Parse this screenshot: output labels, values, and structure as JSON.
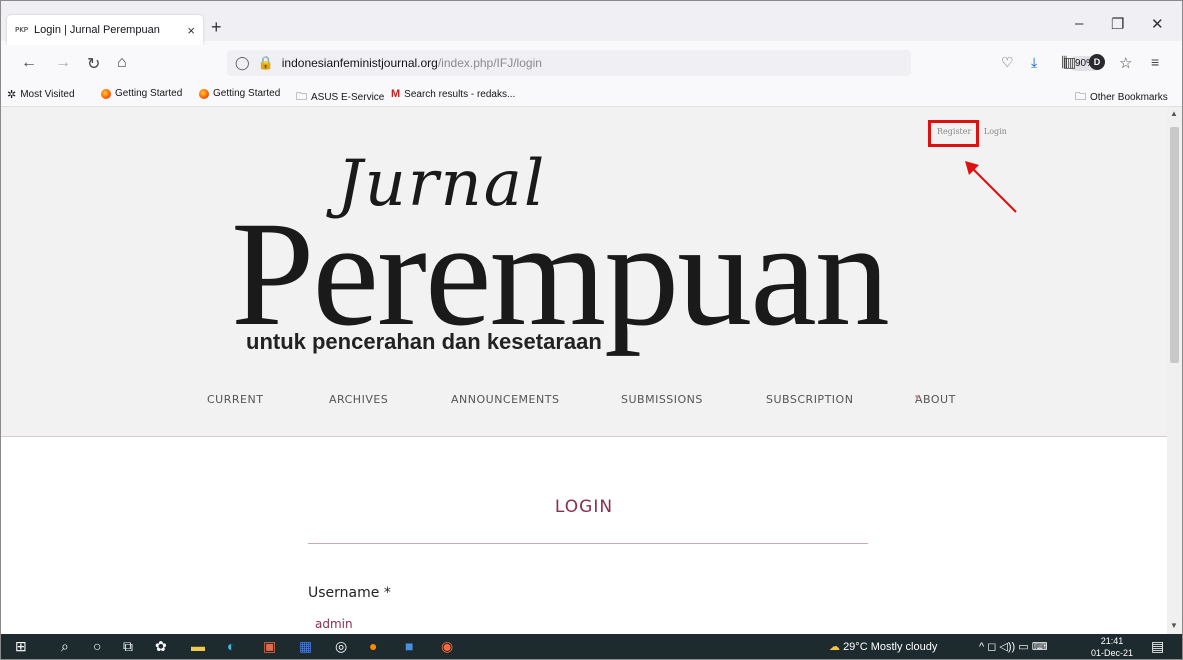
{
  "browser": {
    "tab_favicon": "PKP",
    "tab_title": "Login | Jurnal Perempuan",
    "tab_close": "×",
    "new_tab": "+",
    "url_domain": "indonesianfeministjournal.org",
    "url_path": "/index.php/IFJ/login",
    "zoom": "90%",
    "window_controls": [
      "–",
      "❐",
      "✕"
    ]
  },
  "bookmarks": {
    "items": [
      "Most Visited",
      "Getting Started",
      "Getting Started",
      "ASUS E-Service",
      "Search results - redaks..."
    ],
    "other": "Other Bookmarks"
  },
  "site": {
    "user_links": [
      "Register",
      "Login"
    ],
    "logo_script": "Jurnal",
    "logo_main": "Perempuan",
    "logo_tagline": "untuk pencerahan dan kesetaraan",
    "menu": [
      "CURRENT",
      "ARCHIVES",
      "ANNOUNCEMENTS",
      "SUBMISSIONS",
      "SUBSCRIPTION",
      "ABOUT"
    ],
    "menu_caret": "▾"
  },
  "login": {
    "title": "LOGIN",
    "username_label": "Username *",
    "username_value": "admin"
  },
  "taskbar": {
    "weather": "29°C  Mostly cloudy",
    "time": "21:41",
    "date": "01-Dec-21"
  },
  "colors": {
    "accent": "#8b2e4a",
    "highlight": "#e01010"
  }
}
